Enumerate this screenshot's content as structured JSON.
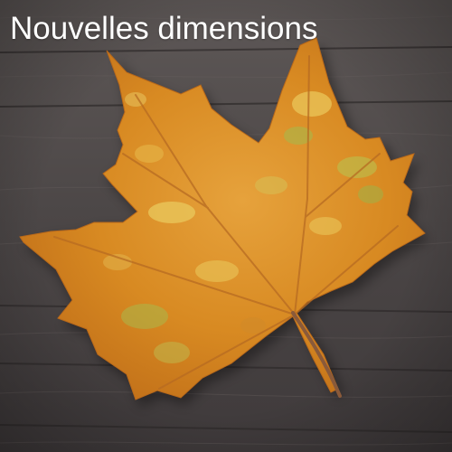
{
  "caption": {
    "text": "Nouvelles dimensions"
  },
  "photo": {
    "subject": "leaf-icon",
    "colors": {
      "wood_dark": "#3e3a3a",
      "wood_light": "#5a5352",
      "leaf_orange": "#d8891f",
      "leaf_amber": "#e2a23a",
      "leaf_yellow": "#e9c65a",
      "leaf_green": "#a9b84a",
      "stem": "#8a5a3a"
    }
  }
}
